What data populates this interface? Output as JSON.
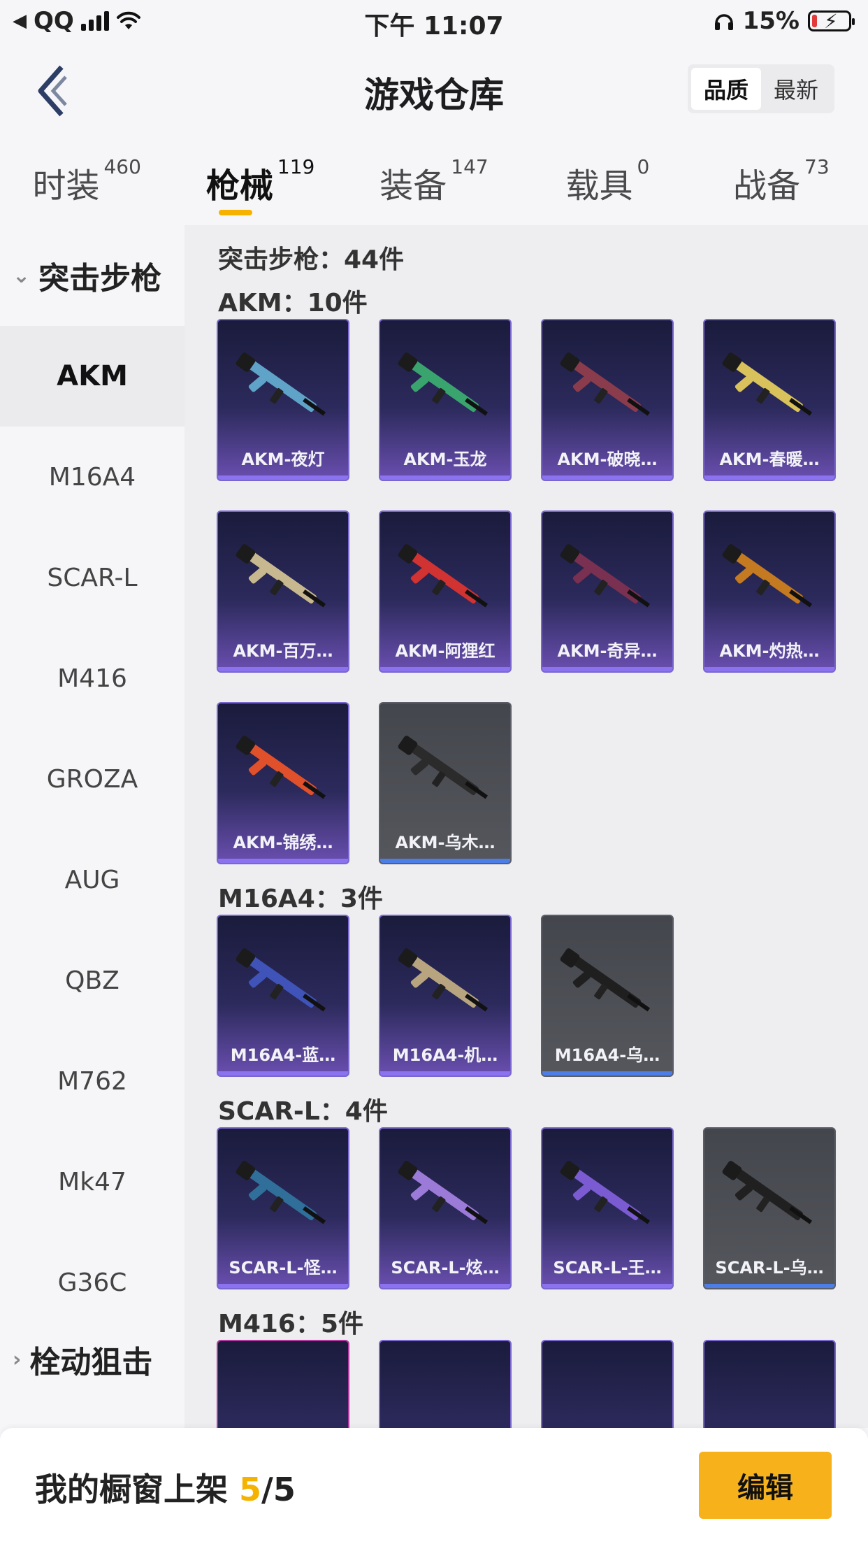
{
  "status_bar": {
    "carrier": "QQ",
    "time": "下午 11:07",
    "battery_percent": "15%",
    "back_arrow_icon": "back-triangle-icon",
    "signal_icon": "signal-icon",
    "wifi_icon": "wifi-icon",
    "headphone_icon": "headphone-icon",
    "battery_icon": "battery-charging-icon"
  },
  "header": {
    "title": "游戏仓库",
    "sort_options": [
      "品质",
      "最新"
    ],
    "active_sort": 0
  },
  "tabs": [
    {
      "label": "时装",
      "count": "460"
    },
    {
      "label": "枪械",
      "count": "119",
      "active": true
    },
    {
      "label": "装备",
      "count": "147"
    },
    {
      "label": "载具",
      "count": "0"
    },
    {
      "label": "战备",
      "count": "73"
    }
  ],
  "sidebar": {
    "group_open": "突击步枪",
    "items": [
      "AKM",
      "M16A4",
      "SCAR-L",
      "M416",
      "GROZA",
      "AUG",
      "QBZ",
      "M762",
      "Mk47",
      "G36C"
    ],
    "active_item": "AKM",
    "group_closed": "栓动狙击"
  },
  "main": {
    "section_total": "突击步枪：44件",
    "groups": [
      {
        "title": "AKM：10件",
        "cards": [
          {
            "label": "AKM-夜灯",
            "bg": "purple"
          },
          {
            "label": "AKM-玉龙",
            "bg": "purple"
          },
          {
            "label": "AKM-破晓…",
            "bg": "purple"
          },
          {
            "label": "AKM-春暖…",
            "bg": "purple"
          },
          {
            "label": "AKM-百万…",
            "bg": "purple"
          },
          {
            "label": "AKM-阿狸红",
            "bg": "purple"
          },
          {
            "label": "AKM-奇异…",
            "bg": "purple"
          },
          {
            "label": "AKM-灼热…",
            "bg": "purple"
          },
          {
            "label": "AKM-锦绣…",
            "bg": "purple"
          },
          {
            "label": "AKM-乌木…",
            "bg": "grey"
          }
        ]
      },
      {
        "title": "M16A4：3件",
        "cards": [
          {
            "label": "M16A4-蓝…",
            "bg": "purple"
          },
          {
            "label": "M16A4-机…",
            "bg": "purple"
          },
          {
            "label": "M16A4-乌…",
            "bg": "grey"
          }
        ]
      },
      {
        "title": "SCAR-L：4件",
        "cards": [
          {
            "label": "SCAR-L-怪…",
            "bg": "purple"
          },
          {
            "label": "SCAR-L-炫…",
            "bg": "purple"
          },
          {
            "label": "SCAR-L-王…",
            "bg": "purple"
          },
          {
            "label": "SCAR-L-乌…",
            "bg": "grey"
          }
        ]
      },
      {
        "title": "M416：5件",
        "cards": []
      }
    ]
  },
  "bottom_bar": {
    "showcase_prefix": "我的橱窗上架",
    "showcase_current": "5",
    "showcase_total": "/5",
    "edit_label": "编辑"
  },
  "colors": {
    "accent": "#f5b300",
    "edit_button": "#f7b21b",
    "card_purple": "#2c2a5c",
    "card_grey": "#55575d"
  }
}
